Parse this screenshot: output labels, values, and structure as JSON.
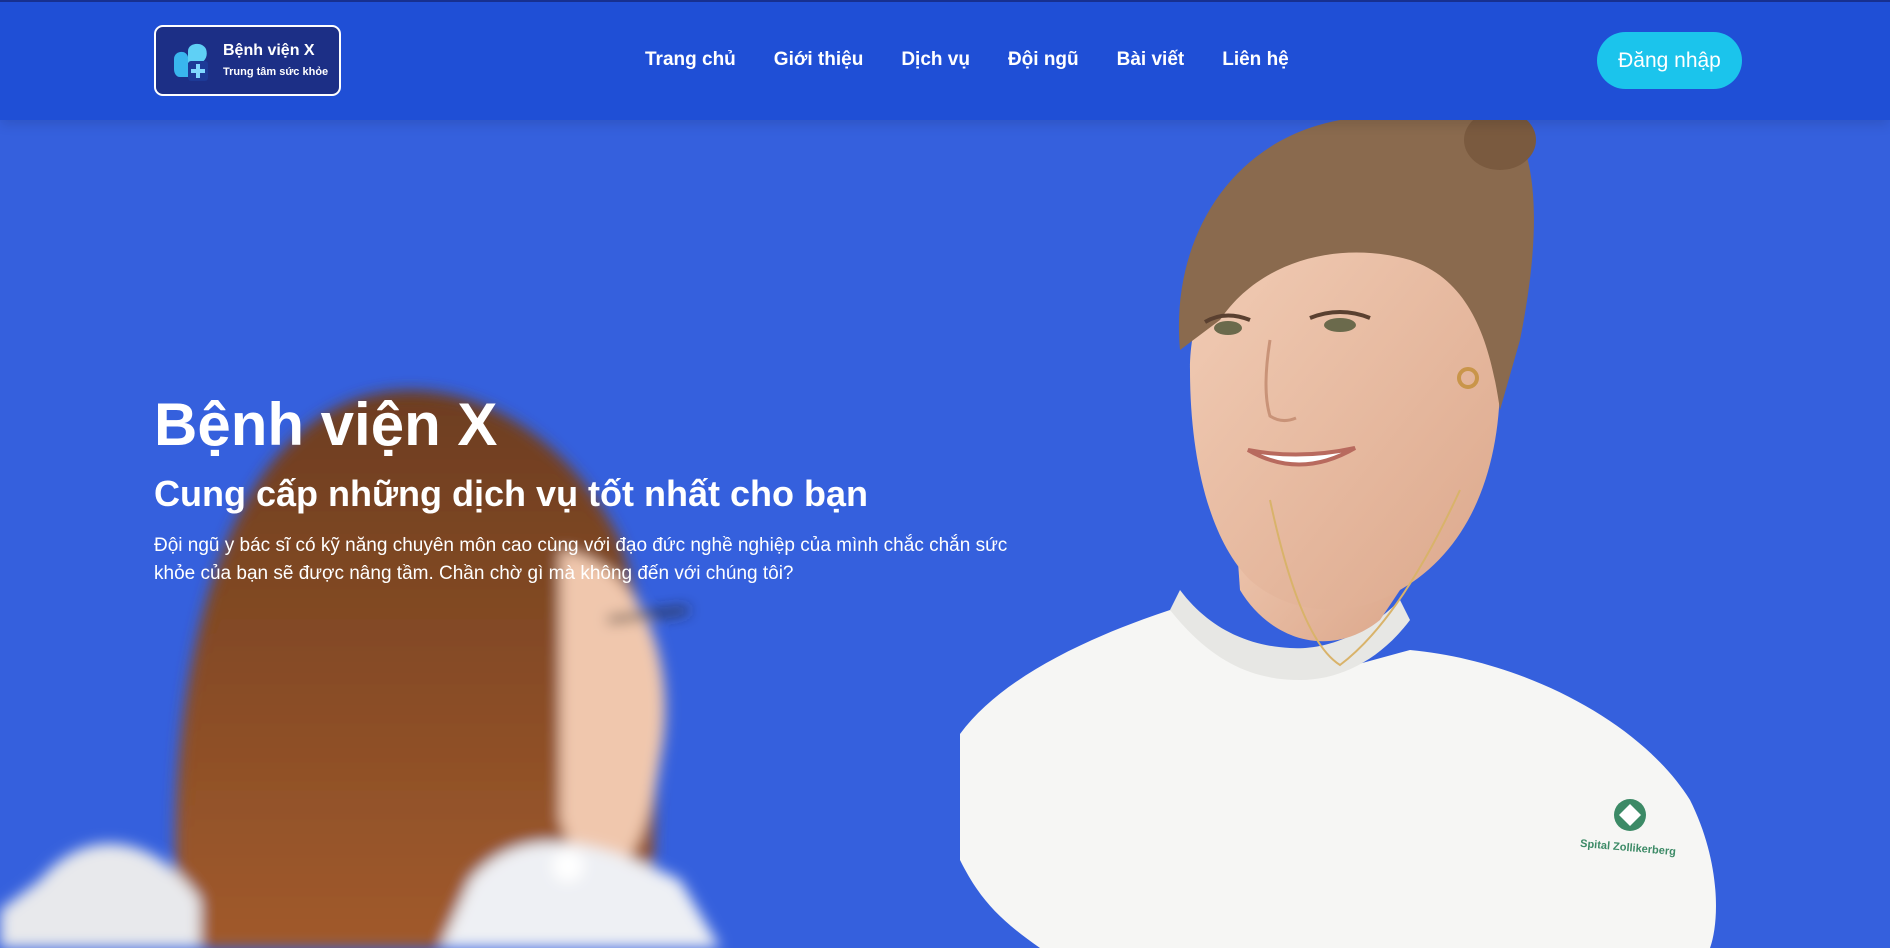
{
  "brand": {
    "name": "Bệnh viện X",
    "tagline": "Trung tâm sức khỏe"
  },
  "nav": {
    "items": [
      "Trang chủ",
      "Giới thiệu",
      "Dịch vụ",
      "Đội ngũ",
      "Bài viết",
      "Liên hệ"
    ],
    "login_label": "Đăng nhập"
  },
  "hero": {
    "title": "Bệnh viện X",
    "subtitle": "Cung cấp những dịch vụ tốt nhất cho bạn",
    "description": "Đội ngũ y bác sĩ có kỹ năng chuyên môn cao cùng với đạo đức nghề nghiệp của mình chắc chắn sức khỏe của bạn sẽ được nâng tầm. Chần chờ gì mà không đến với chúng tôi?",
    "uniform_logo_text": "Spital Zollikerberg"
  },
  "colors": {
    "header_bg": "#1f4fd6",
    "hero_bg": "#3560dd",
    "login_button": "#1bc4ec",
    "logo_box": "#1c2f86"
  }
}
